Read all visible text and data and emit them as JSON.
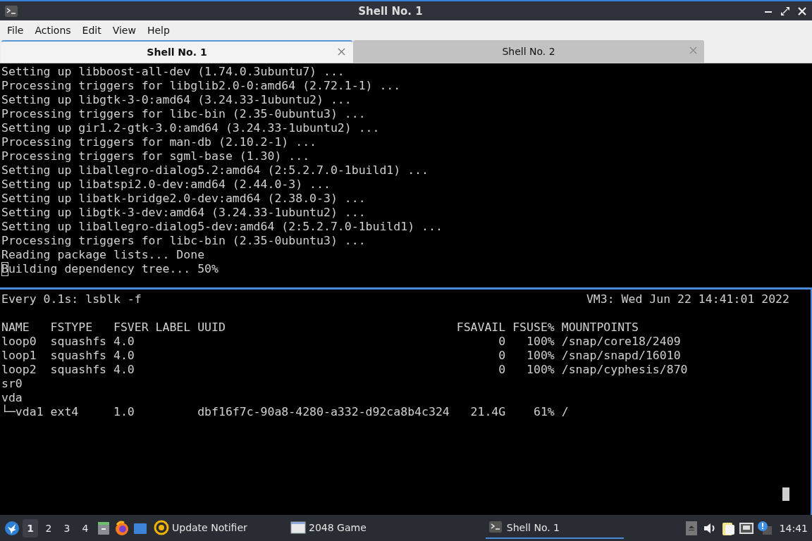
{
  "window": {
    "title": "Shell No. 1"
  },
  "menu": [
    "File",
    "Actions",
    "Edit",
    "View",
    "Help"
  ],
  "tabs": [
    {
      "label": "Shell No. 1",
      "selected": true
    },
    {
      "label": "Shell No. 2",
      "selected": false
    }
  ],
  "panes": [
    {
      "focused": false,
      "lines": [
        "Setting up libboost-all-dev (1.74.0.3ubuntu7) ...",
        "Processing triggers for libglib2.0-0:amd64 (2.72.1-1) ...",
        "Setting up libgtk-3-0:amd64 (3.24.33-1ubuntu2) ...",
        "Processing triggers for libc-bin (2.35-0ubuntu3) ...",
        "Setting up gir1.2-gtk-3.0:amd64 (3.24.33-1ubuntu2) ...",
        "Processing triggers for man-db (2.10.2-1) ...",
        "Processing triggers for sgml-base (1.30) ...",
        "Setting up liballegro-dialog5.2:amd64 (2:5.2.7.0-1build1) ...",
        "Setting up libatspi2.0-dev:amd64 (2.44.0-3) ...",
        "Setting up libatk-bridge2.0-dev:amd64 (2.38.0-3) ...",
        "Setting up libgtk-3-dev:amd64 (3.24.33-1ubuntu2) ...",
        "Setting up liballegro-dialog5-dev:amd64 (2:5.2.7.0-1build1) ...",
        "Processing triggers for libc-bin (2.35-0ubuntu3) ...",
        "Reading package lists... Done",
        "Building dependency tree... 50%"
      ]
    },
    {
      "focused": true,
      "header_left": "Every 0.1s: lsblk -f",
      "header_right": "VM3: Wed Jun 22 14:41:01 2022",
      "lines": [
        "NAME   FSTYPE   FSVER LABEL UUID                                 FSAVAIL FSUSE% MOUNTPOINTS",
        "loop0  squashfs 4.0                                                    0   100% /snap/core18/2409",
        "loop1  squashfs 4.0                                                    0   100% /snap/snapd/16010",
        "loop2  squashfs 4.0                                                    0   100% /snap/cyphesis/870",
        "sr0",
        "vda",
        "└─vda1 ext4     1.0         dbf16f7c-90a8-4280-a332-d92ca8b4c324   21.4G    61% /"
      ]
    }
  ],
  "taskbar": {
    "desktops": [
      {
        "label": "1",
        "selected": true
      },
      {
        "label": "2",
        "selected": false
      },
      {
        "label": "3",
        "selected": false
      },
      {
        "label": "4",
        "selected": false
      }
    ],
    "tasks": [
      {
        "label": "Update Notifier",
        "kind": "notifier",
        "selected": false
      },
      {
        "label": "2048 Game",
        "kind": "window",
        "selected": false
      },
      {
        "label": "Shell No. 1",
        "kind": "terminal",
        "selected": true
      }
    ],
    "clock": "14:41"
  }
}
